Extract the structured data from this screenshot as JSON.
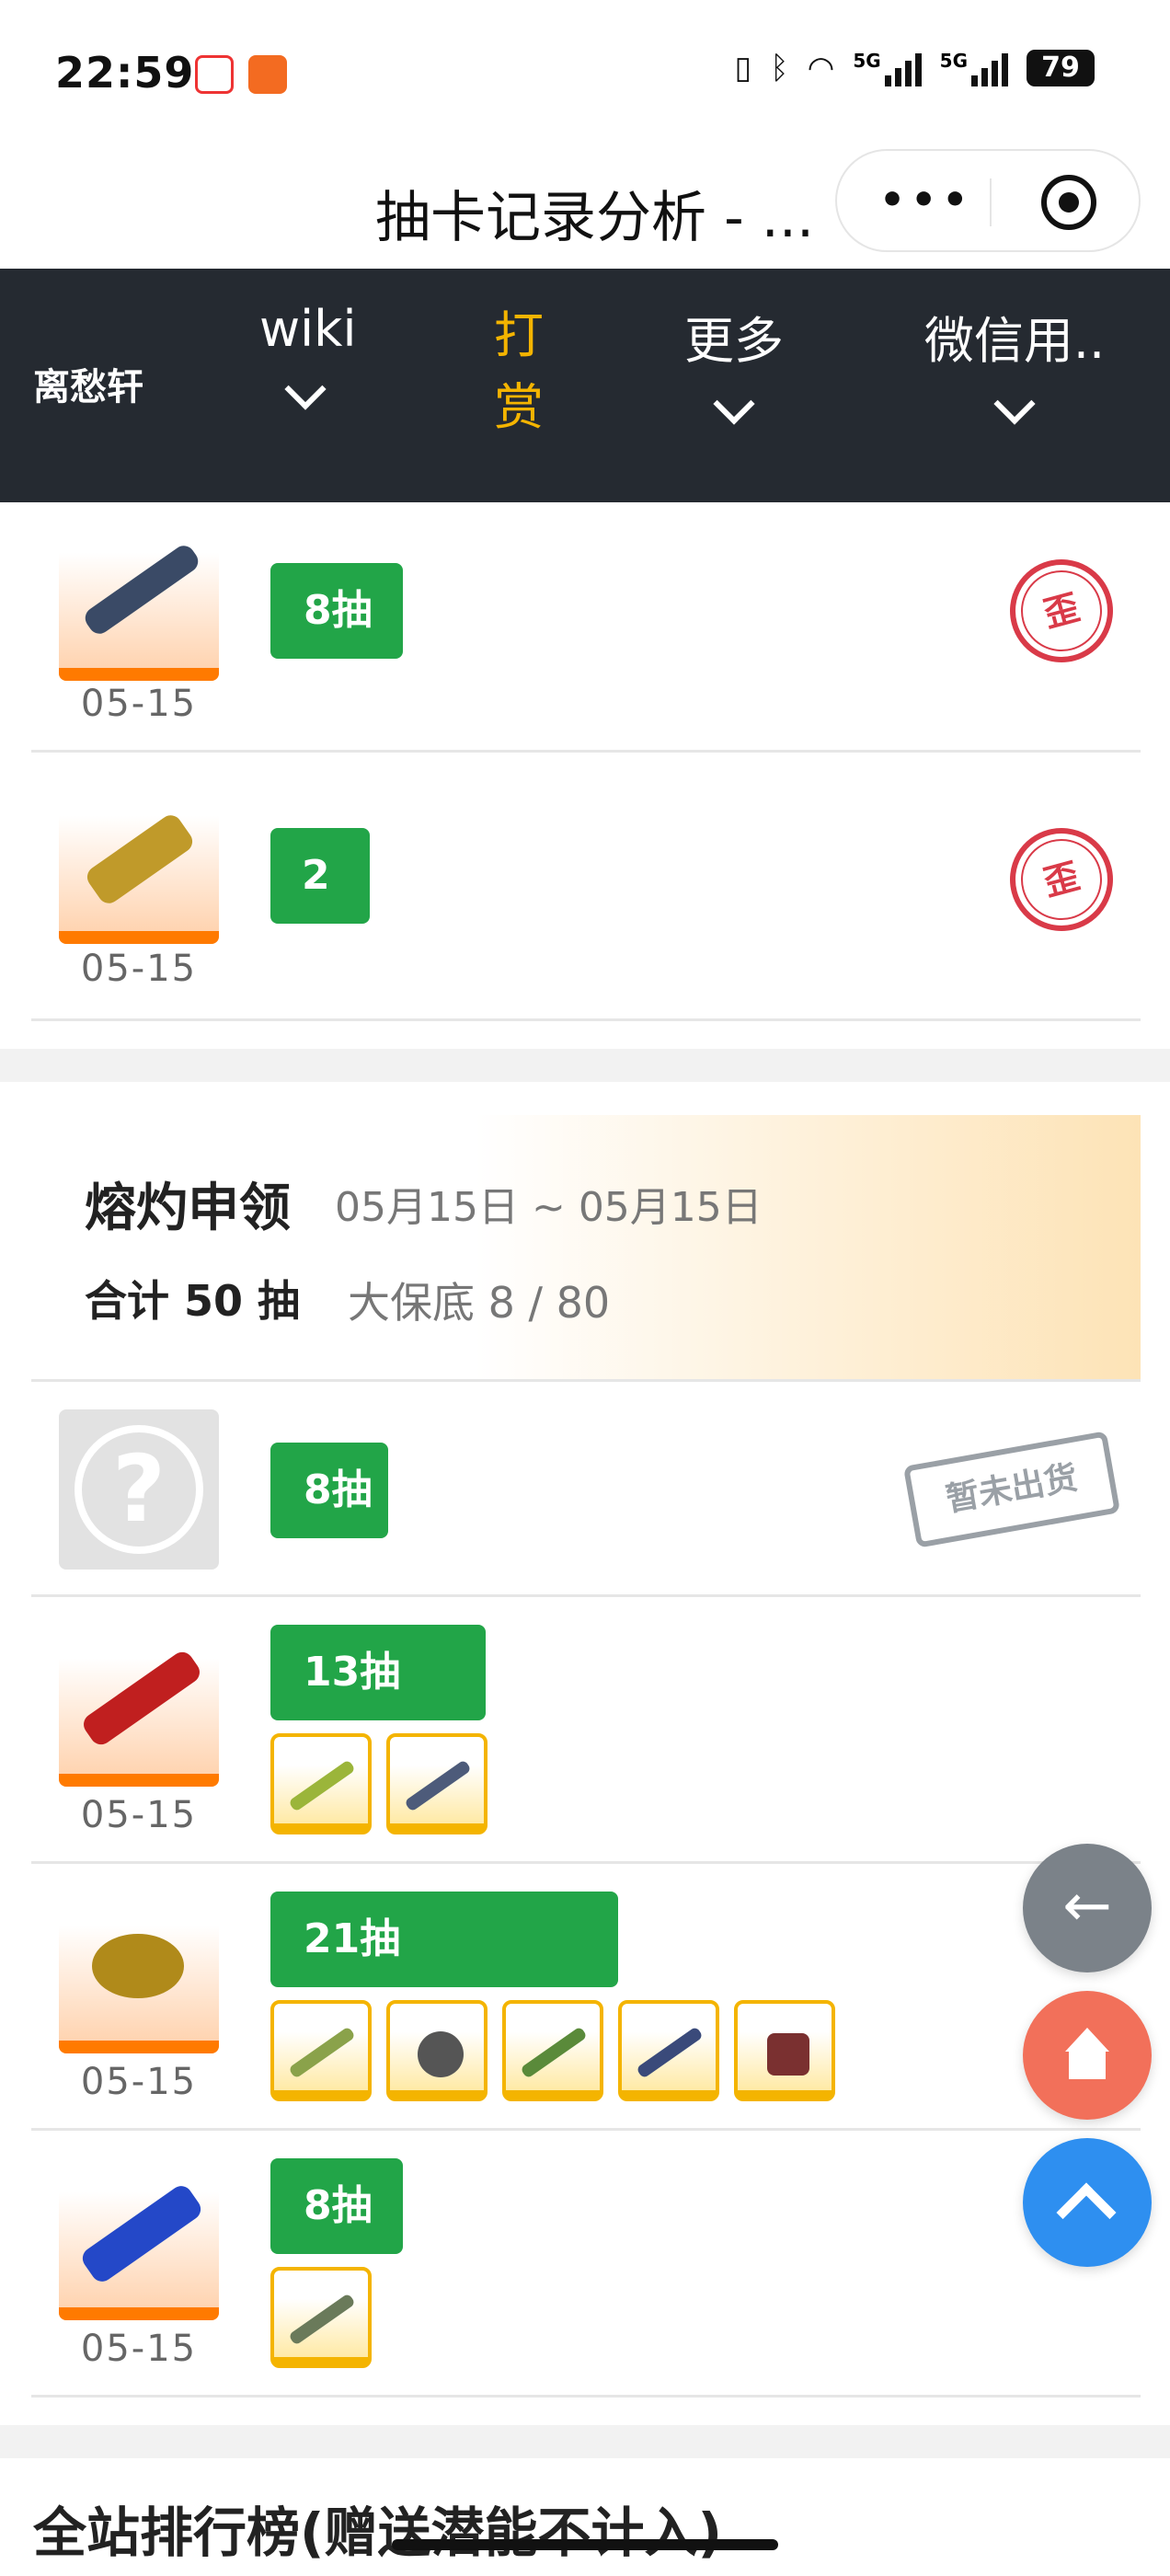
{
  "status_bar": {
    "time": "22:59",
    "battery": "79",
    "signal1": "5G",
    "signal2": "5G"
  },
  "title_bar": {
    "title": "抽卡记录分析 - ..."
  },
  "nav": {
    "user": "离愁轩",
    "items": [
      {
        "label": "wiki"
      },
      {
        "label": "打赏",
        "line1": "打",
        "line2": "赏"
      },
      {
        "label": "更多"
      },
      {
        "label": "微信用.."
      }
    ]
  },
  "prev_rows": [
    {
      "date": "05-15",
      "pulls": "8抽",
      "stamp": "歪"
    },
    {
      "date": "05-15",
      "pulls": "2抽",
      "stamp": "歪"
    }
  ],
  "banner": {
    "name": "熔灼申领",
    "range": "05月15日 ~ 05月15日",
    "total": "合计 50 抽",
    "pity": "大保底 8 / 80"
  },
  "rows": [
    {
      "date": "",
      "pulls": "8抽",
      "stamp": "暂未出货"
    },
    {
      "date": "05-15",
      "pulls": "13抽"
    },
    {
      "date": "05-15",
      "pulls": "21抽"
    },
    {
      "date": "05-15",
      "pulls": "8抽"
    }
  ],
  "next_section_title": "全站排行榜(赠送潜能不计入)",
  "colors": {
    "nav_bg": "#252a31",
    "gold": "#f4b400",
    "green": "#22a548",
    "red_stamp": "#d93a48"
  },
  "fabs": {
    "back_icon": "arrow-left-icon",
    "home_icon": "home-icon",
    "up_icon": "chevron-up-icon"
  }
}
